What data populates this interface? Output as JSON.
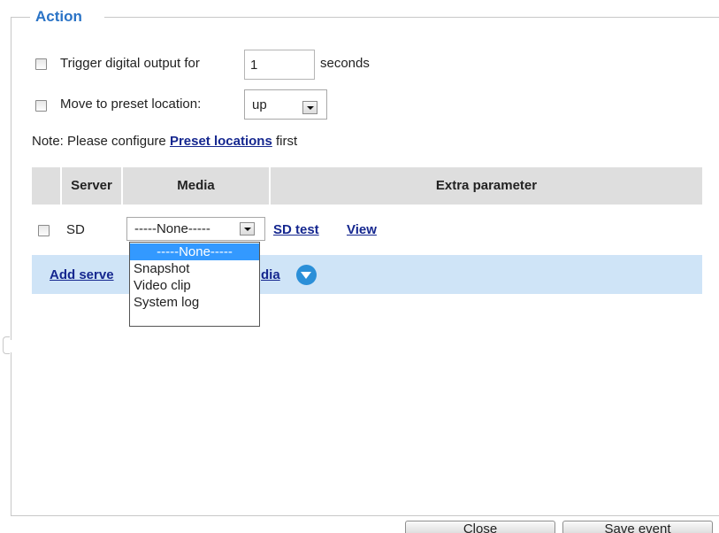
{
  "action_section": {
    "legend": "Action",
    "trigger_output": {
      "label": "Trigger digital output for",
      "value": "1",
      "unit": "seconds",
      "checked": false
    },
    "move_preset": {
      "label": "Move to preset location:",
      "selected": "up",
      "checked": false
    },
    "note": {
      "prefix": "Note: Please configure ",
      "link": "Preset locations",
      "suffix": " first"
    }
  },
  "server_table": {
    "headers": [
      "Server",
      "Media",
      "Extra parameter"
    ],
    "rows": [
      {
        "checked": false,
        "server": "SD",
        "media_selected": "-----None-----",
        "test_link": "SD test",
        "view_link": "View"
      }
    ]
  },
  "media_dropdown": {
    "options": [
      "-----None-----",
      "Snapshot",
      "Video clip",
      "System log"
    ],
    "highlighted_index": 0
  },
  "add_server": {
    "label_left": "Add serve",
    "label_right": "dia"
  },
  "footer": {
    "close_label": "Close",
    "save_label": "Save event"
  },
  "colors": {
    "legend": "#2a73c6",
    "link": "#15278f",
    "header_bg": "#dedede",
    "add_bar_bg": "#cfe4f7",
    "dropdown_highlight": "#3399ff",
    "circle_icon": "#2b8fd8"
  }
}
